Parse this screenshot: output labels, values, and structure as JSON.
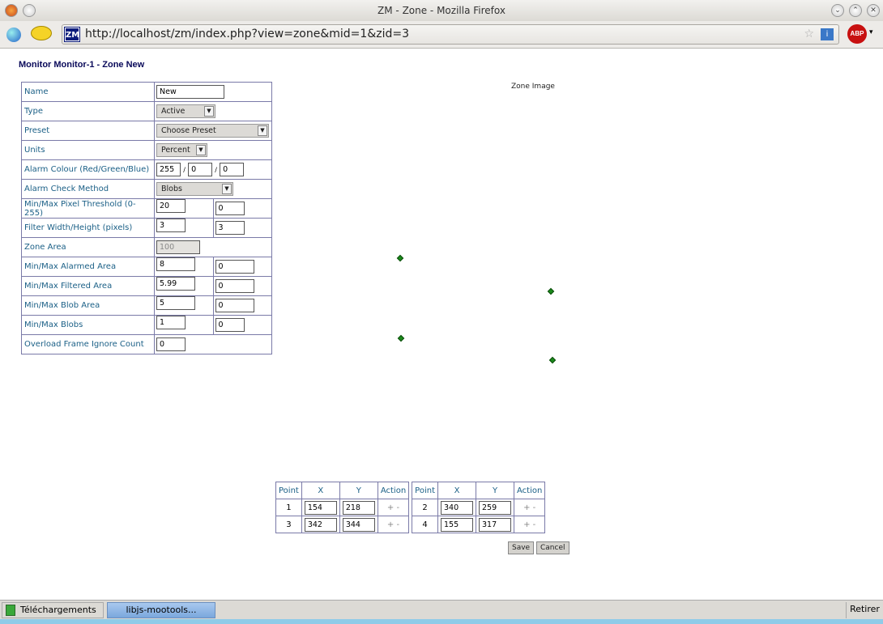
{
  "window": {
    "title": "ZM - Zone - Mozilla Firefox",
    "url": "http://localhost/zm/index.php?view=zone&mid=1&zid=3"
  },
  "page": {
    "heading": "Monitor Monitor-1 - Zone New",
    "zone_image_label": "Zone Image"
  },
  "form": {
    "name": {
      "label": "Name",
      "value": "New"
    },
    "type": {
      "label": "Type",
      "value": "Active"
    },
    "preset": {
      "label": "Preset",
      "value": "Choose Preset"
    },
    "units": {
      "label": "Units",
      "value": "Percent"
    },
    "alarm_colour": {
      "label": "Alarm Colour (Red/Green/Blue)",
      "red": "255",
      "green": "0",
      "blue": "0",
      "sep": "/"
    },
    "check_method": {
      "label": "Alarm Check Method",
      "value": "Blobs"
    },
    "pixel_threshold": {
      "label": "Min/Max Pixel Threshold (0-255)",
      "min": "20",
      "max": "0"
    },
    "filter_size": {
      "label": "Filter Width/Height (pixels)",
      "min": "3",
      "max": "3"
    },
    "zone_area": {
      "label": "Zone Area",
      "value": "100"
    },
    "alarmed_area": {
      "label": "Min/Max Alarmed Area",
      "min": "8",
      "max": "0"
    },
    "filtered_area": {
      "label": "Min/Max Filtered Area",
      "min": "5.99",
      "max": "0"
    },
    "blob_area": {
      "label": "Min/Max Blob Area",
      "min": "5",
      "max": "0"
    },
    "blobs": {
      "label": "Min/Max Blobs",
      "min": "1",
      "max": "0"
    },
    "overload": {
      "label": "Overload Frame Ignore Count",
      "value": "0"
    }
  },
  "points_table": {
    "headers": [
      "Point",
      "X",
      "Y",
      "Action"
    ],
    "points": [
      {
        "n": "1",
        "x": "154",
        "y": "218",
        "action": "+ -"
      },
      {
        "n": "2",
        "x": "340",
        "y": "259",
        "action": "+ -"
      },
      {
        "n": "3",
        "x": "342",
        "y": "344",
        "action": "+ -"
      },
      {
        "n": "4",
        "x": "155",
        "y": "317",
        "action": "+ -"
      }
    ]
  },
  "buttons": {
    "save": "Save",
    "cancel": "Cancel"
  },
  "statusbar": {
    "downloads": "Téléchargements",
    "task": "libjs-mootools...",
    "dismiss": "Retirer"
  },
  "colors": {
    "point_marker": "#1a8a1a",
    "label_text": "#1a5f86",
    "heading": "#0a0a5a"
  }
}
